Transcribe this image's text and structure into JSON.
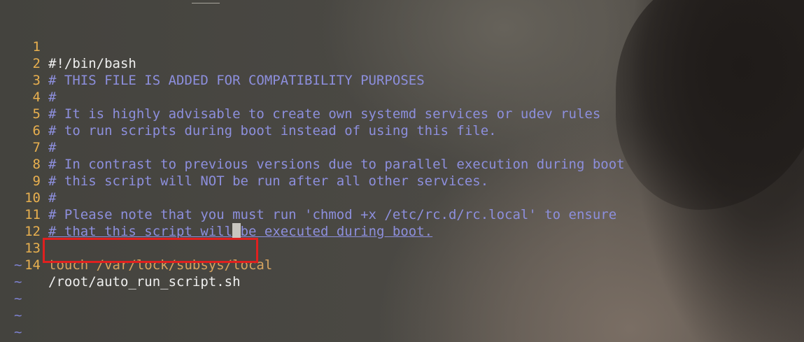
{
  "editor": {
    "lines": [
      {
        "num": "1",
        "text": "#!/bin/bash"
      },
      {
        "num": "2",
        "text": "# THIS FILE IS ADDED FOR COMPATIBILITY PURPOSES"
      },
      {
        "num": "3",
        "text": "#"
      },
      {
        "num": "4",
        "text": "# It is highly advisable to create own systemd services or udev rules"
      },
      {
        "num": "5",
        "text": "# to run scripts during boot instead of using this file."
      },
      {
        "num": "6",
        "text": "#"
      },
      {
        "num": "7",
        "text": "# In contrast to previous versions due to parallel execution during boot"
      },
      {
        "num": "8",
        "text": "# this script will NOT be run after all other services."
      },
      {
        "num": "9",
        "text": "#"
      },
      {
        "num": "10",
        "text": "# Please note that you must run 'chmod +x /etc/rc.d/rc.local' to ensure"
      },
      {
        "num": "11",
        "text_before": "# that this script will",
        "cursor_char": " ",
        "text_after": "be executed during boot."
      },
      {
        "num": "12",
        "text": ""
      },
      {
        "num": "13",
        "keyword": "touch",
        "text": " /var/lock/subsys/local"
      },
      {
        "num": "14",
        "text": "/root/auto_run_script.sh"
      }
    ],
    "tilde": "~"
  },
  "colors": {
    "line_number": "#e8b04f",
    "comment": "#8d8fdd",
    "plain": "#efefef",
    "keyword": "#d6a460",
    "highlight_box": "#e0201f"
  }
}
